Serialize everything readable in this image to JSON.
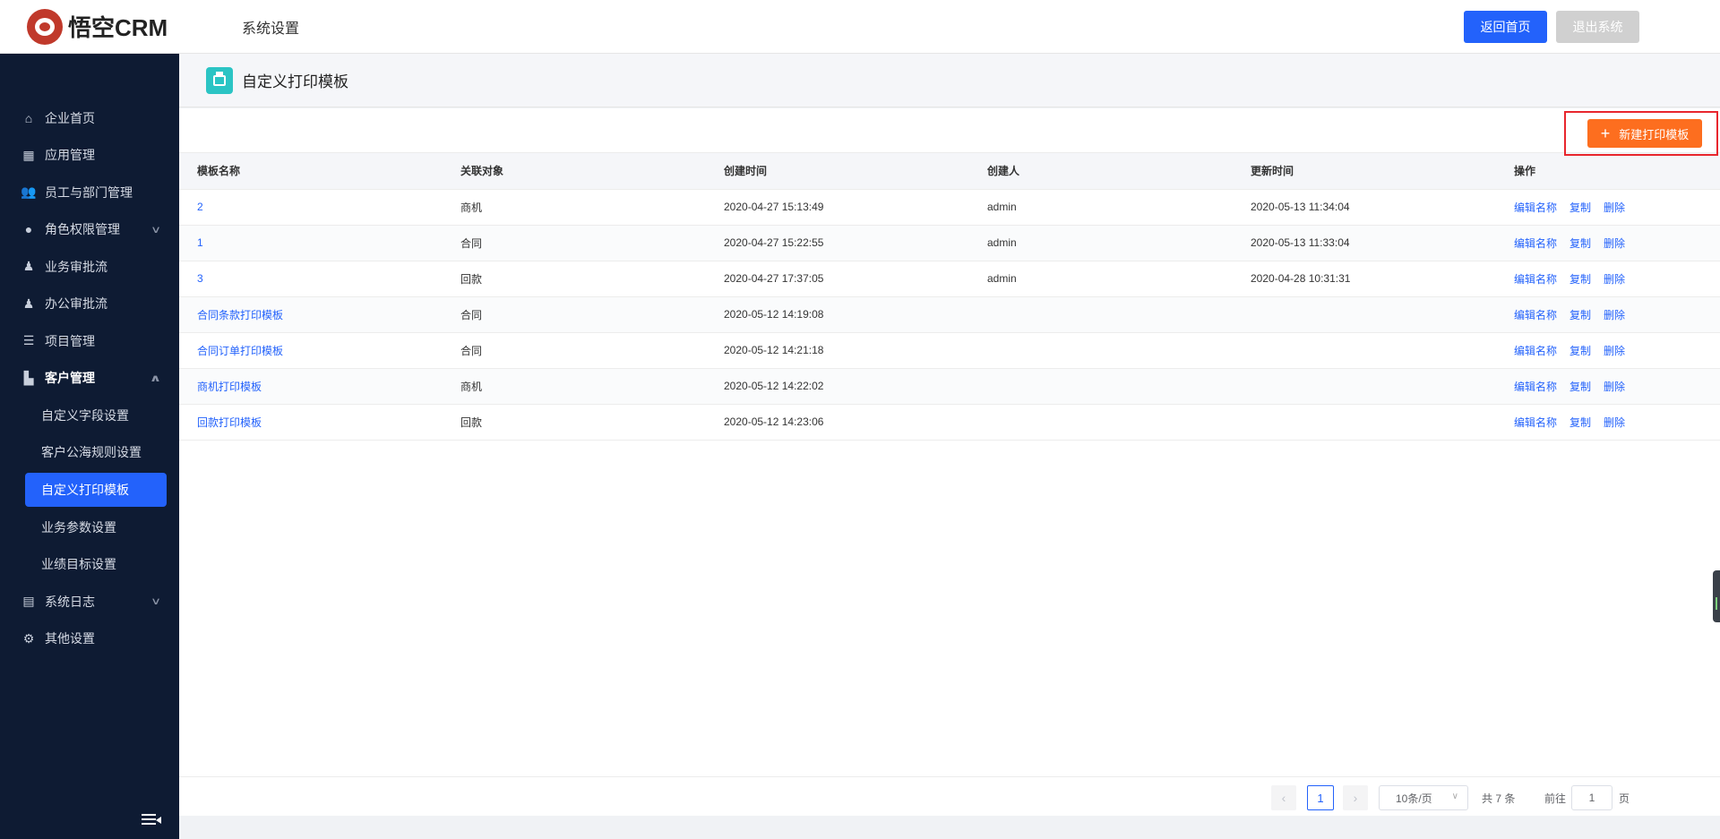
{
  "header": {
    "logo_text": "悟空CRM",
    "section_title": "系统设置",
    "home_button": "返回首页",
    "exit_button": "退出系统"
  },
  "sidebar": {
    "items": [
      {
        "label": "企业首页",
        "icon": "home-icon"
      },
      {
        "label": "应用管理",
        "icon": "grid-icon"
      },
      {
        "label": "员工与部门管理",
        "icon": "users-icon"
      },
      {
        "label": "角色权限管理",
        "icon": "user-icon",
        "expandable": true,
        "expanded": false
      },
      {
        "label": "业务审批流",
        "icon": "approval-icon"
      },
      {
        "label": "办公审批流",
        "icon": "approval-icon"
      },
      {
        "label": "项目管理",
        "icon": "list-icon"
      },
      {
        "label": "客户管理",
        "icon": "building-icon",
        "expandable": true,
        "expanded": true
      }
    ],
    "subitems": [
      {
        "label": "自定义字段设置"
      },
      {
        "label": "客户公海规则设置"
      },
      {
        "label": "自定义打印模板",
        "active": true
      },
      {
        "label": "业务参数设置"
      },
      {
        "label": "业绩目标设置"
      }
    ],
    "after_items": [
      {
        "label": "系统日志",
        "icon": "log-icon",
        "expandable": true
      },
      {
        "label": "其他设置",
        "icon": "gear-icon"
      }
    ]
  },
  "page": {
    "title": "自定义打印模板",
    "new_button": "新建打印模板"
  },
  "table": {
    "headers": [
      "模板名称",
      "关联对象",
      "创建时间",
      "创建人",
      "更新时间",
      "操作"
    ],
    "rows": [
      {
        "name": "2",
        "object": "商机",
        "created": "2020-04-27 15:13:49",
        "creator": "admin",
        "updated": "2020-05-13 11:34:04"
      },
      {
        "name": "1",
        "object": "合同",
        "created": "2020-04-27 15:22:55",
        "creator": "admin",
        "updated": "2020-05-13 11:33:04"
      },
      {
        "name": "3",
        "object": "回款",
        "created": "2020-04-27 17:37:05",
        "creator": "admin",
        "updated": "2020-04-28 10:31:31"
      },
      {
        "name": "合同条款打印模板",
        "object": "合同",
        "created": "2020-05-12 14:19:08",
        "creator": "",
        "updated": ""
      },
      {
        "name": "合同订单打印模板",
        "object": "合同",
        "created": "2020-05-12 14:21:18",
        "creator": "",
        "updated": ""
      },
      {
        "name": "商机打印模板",
        "object": "商机",
        "created": "2020-05-12 14:22:02",
        "creator": "",
        "updated": ""
      },
      {
        "name": "回款打印模板",
        "object": "回款",
        "created": "2020-05-12 14:23:06",
        "creator": "",
        "updated": ""
      }
    ],
    "actions": [
      "编辑名称",
      "复制",
      "删除"
    ]
  },
  "pagination": {
    "current_page": "1",
    "page_size": "10条/页",
    "total": "共 7 条",
    "goto_label": "前往",
    "goto_value": "1",
    "page_suffix": "页"
  },
  "colors": {
    "primary": "#2362fb",
    "sidebar_bg": "#0e1b33",
    "new_button": "#fd6e1f",
    "highlight_border": "#e8262d"
  }
}
